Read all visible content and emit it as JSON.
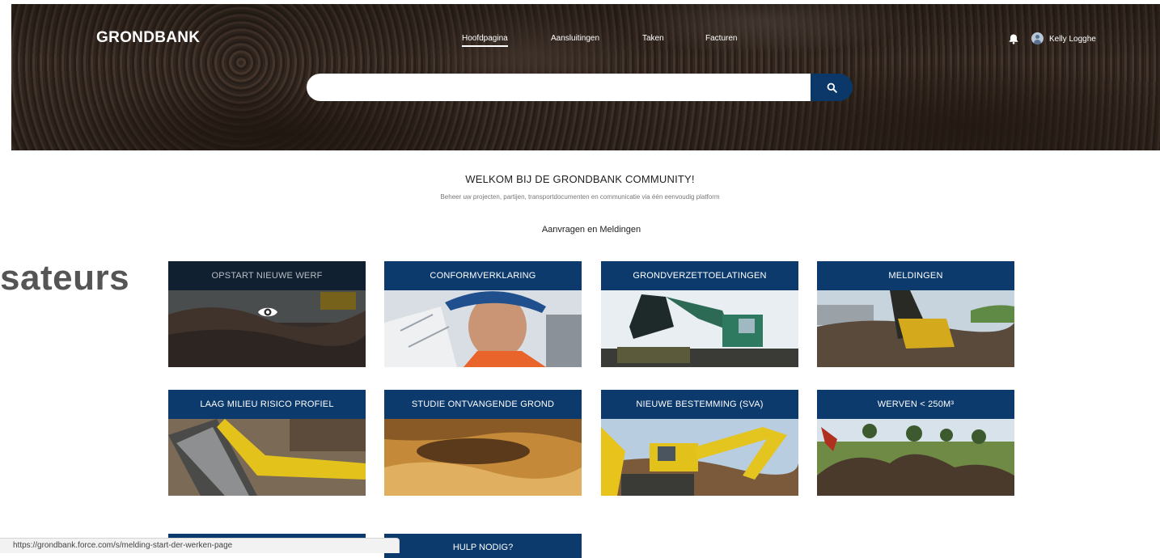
{
  "header": {
    "logo": "GRONDBANK",
    "nav": [
      {
        "label": "Hoofdpagina",
        "active": true
      },
      {
        "label": "Aansluitingen",
        "active": false
      },
      {
        "label": "Taken",
        "active": false
      },
      {
        "label": "Facturen",
        "active": false
      }
    ],
    "user_name": "Kelly Logghe",
    "search": {
      "placeholder": "",
      "value": ""
    }
  },
  "welcome": {
    "title": "WELKOM BIJ DE GRONDBANK COMMUNITY!",
    "subtitle": "Beheer uw projecten, partijen, transportdocumenten en communicatie via één eenvoudig platform"
  },
  "section_title": "Aanvragen en Meldingen",
  "side_overlay_text": "sateurs",
  "tiles": [
    {
      "label": "OPSTART NIEUWE WERF",
      "icon": "eye-icon"
    },
    {
      "label": "CONFORMVERKLARING"
    },
    {
      "label": "GRONDVERZETTOELATINGEN"
    },
    {
      "label": "MELDINGEN"
    },
    {
      "label": "LAAG MILIEU RISICO PROFIEL"
    },
    {
      "label": "STUDIE ONTVANGENDE GROND"
    },
    {
      "label": "NIEUWE BESTEMMING (SVA)"
    },
    {
      "label": "WERVEN < 250M³"
    },
    {
      "label": "HULP NODIG?"
    }
  ],
  "status_bar_url": "https://grondbank.force.com/s/melding-start-der-werken-page",
  "colors": {
    "accent": "#0d3a6c",
    "search_button": "#0b3868",
    "hovered_tile_header": "#112031"
  }
}
